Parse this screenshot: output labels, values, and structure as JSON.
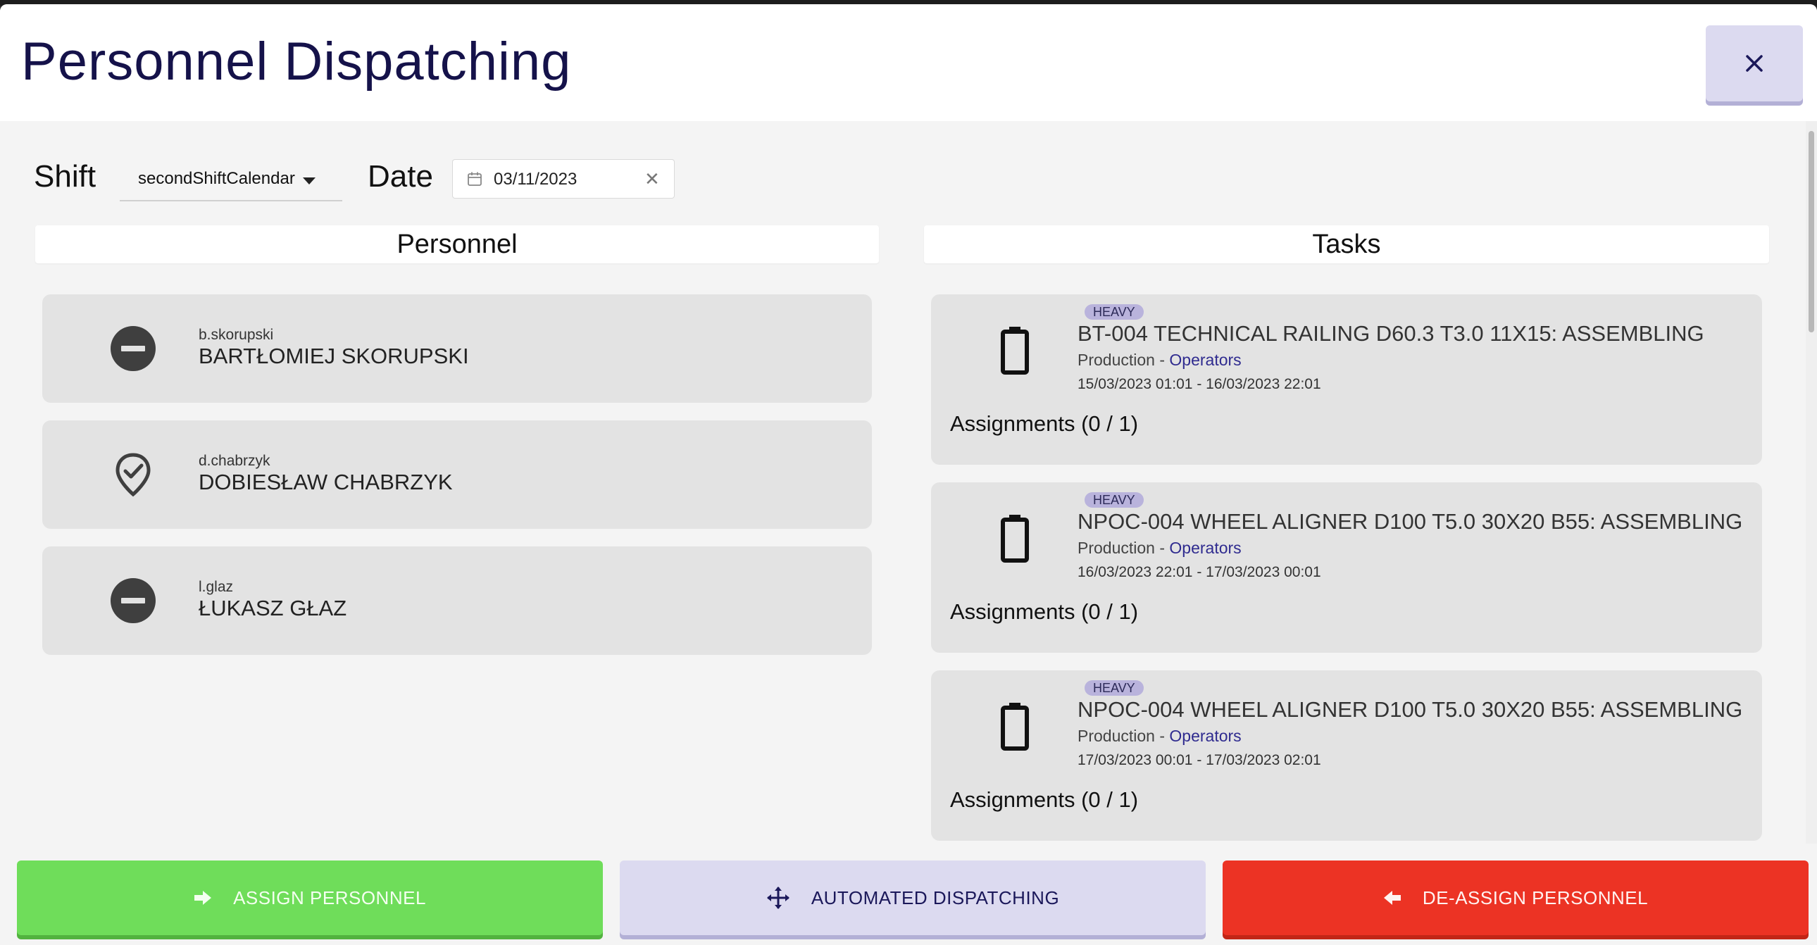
{
  "modal": {
    "title": "Personnel Dispatching"
  },
  "filters": {
    "shift_label": "Shift",
    "shift_value": "secondShiftCalendar",
    "date_label": "Date",
    "date_value": "03/11/2023"
  },
  "columns": {
    "personnel_header": "Personnel",
    "tasks_header": "Tasks"
  },
  "personnel": [
    {
      "login": "b.skorupski",
      "name": "BARTŁOMIEJ SKORUPSKI",
      "status_icon": "minus-circle-icon"
    },
    {
      "login": "d.chabrzyk",
      "name": "DOBIESŁAW CHABRZYK",
      "status_icon": "location-check-icon"
    },
    {
      "login": "l.glaz",
      "name": "ŁUKASZ GŁAZ",
      "status_icon": "minus-circle-icon"
    }
  ],
  "tasks": [
    {
      "badge": "HEAVY",
      "title": "BT-004 TECHNICAL RAILING D60.3 T3.0 11X15: ASSEMBLING",
      "department": "Production -",
      "role": "Operators",
      "dates": "15/03/2023 01:01 - 16/03/2023 22:01",
      "assignments": "Assignments (0 / 1)",
      "icon": "battery-icon"
    },
    {
      "badge": "HEAVY",
      "title": "NPOC-004 WHEEL ALIGNER D100 T5.0 30X20 B55: ASSEMBLING",
      "department": "Production -",
      "role": "Operators",
      "dates": "16/03/2023 22:01 - 17/03/2023 00:01",
      "assignments": "Assignments (0 / 1)",
      "icon": "battery-icon"
    },
    {
      "badge": "HEAVY",
      "title": "NPOC-004 WHEEL ALIGNER D100 T5.0 30X20 B55: ASSEMBLING",
      "department": "Production -",
      "role": "Operators",
      "dates": "17/03/2023 00:01 - 17/03/2023 02:01",
      "assignments": "Assignments (0 / 1)",
      "icon": "battery-icon"
    }
  ],
  "actions": {
    "assign_label": "ASSIGN PERSONNEL",
    "automated_label": "AUTOMATED DISPATCHING",
    "deassign_label": "DE-ASSIGN PERSONNEL"
  },
  "colors": {
    "title": "#15124a",
    "assign": "#6fdd5a",
    "automated": "#dcdaf0",
    "deassign": "#ec3324",
    "badge": "#b9b3dc",
    "link": "#2f2b8f"
  }
}
